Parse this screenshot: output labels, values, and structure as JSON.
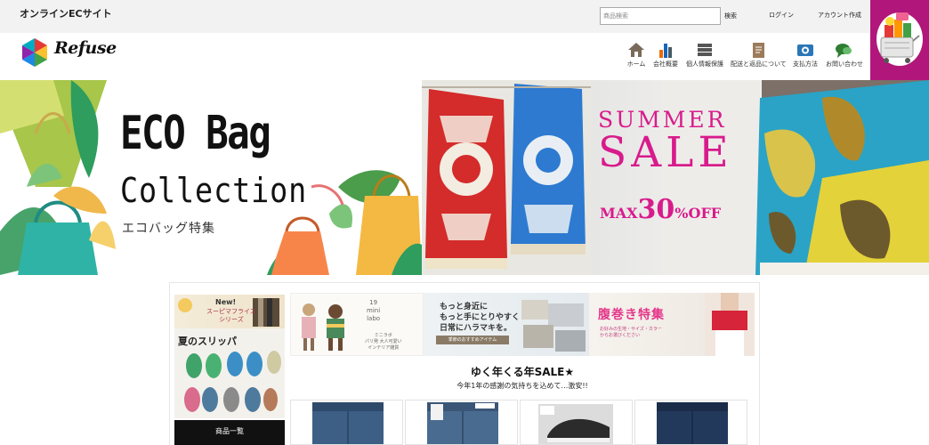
{
  "header": {
    "site_name": "オンラインECサイト",
    "search_placeholder": "商品検索",
    "search_button": "検索",
    "login": "ログイン",
    "create_account": "アカウント作成",
    "logo_text": "Refuse"
  },
  "nav": [
    {
      "label": "ホーム",
      "icon": "home-icon"
    },
    {
      "label": "会社概要",
      "icon": "bar-chart-icon"
    },
    {
      "label": "個人情報保護",
      "icon": "list-icon"
    },
    {
      "label": "配送と返品について",
      "icon": "document-icon"
    },
    {
      "label": "支払方法",
      "icon": "payment-icon"
    },
    {
      "label": "お問い合わせ",
      "icon": "chat-bubble-icon"
    }
  ],
  "hero": {
    "eco_title": "ECO Bag",
    "eco_subtitle": "Collection",
    "eco_jp": "エコバッグ特集",
    "sale_top": "SUMMER",
    "sale_big": "SALE",
    "sale_max_prefix": "MAX",
    "sale_max_value": "30",
    "sale_max_suffix": "%OFF"
  },
  "side": {
    "new_label": "New!",
    "new_sub": "スーピマフライス\nシリーズ",
    "slipper_title": "夏のスリッパ",
    "product_list_button": "商品一覧"
  },
  "banners": {
    "mini_labo": "19\nmini\nlabo",
    "mini_labo_sub": "ミニラボ\nパリ発 大人可愛い\nインテリア雑貨",
    "message": "もっと身近に\nもっと手にとりやすく\n日常にハラマキを。",
    "season_tag": "季節のおすすめアイテム",
    "haramaki_title": "腹巻き特集",
    "haramaki_sub": "お好みの生地・サイズ・カラー\nからお選びください"
  },
  "sale": {
    "heading": "ゆく年くる年SALE★",
    "description": "今年1年の感謝の気持ちを込めて…激安!!"
  },
  "colors": {
    "accent_pink": "#d81b8c",
    "cart_bg": "#b1167a",
    "topbar_bg": "#f2f2f2"
  }
}
